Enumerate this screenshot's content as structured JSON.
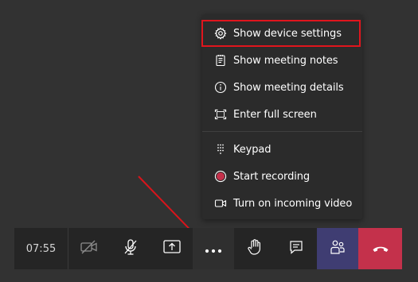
{
  "menu": {
    "items": [
      {
        "label": "Show device settings",
        "icon": "gear-icon"
      },
      {
        "label": "Show meeting notes",
        "icon": "notes-icon"
      },
      {
        "label": "Show meeting details",
        "icon": "info-icon"
      },
      {
        "label": "Enter full screen",
        "icon": "fullscreen-icon"
      },
      {
        "label": "Keypad",
        "icon": "keypad-icon"
      },
      {
        "label": "Start recording",
        "icon": "record-icon"
      },
      {
        "label": "Turn on incoming video",
        "icon": "video-icon"
      }
    ]
  },
  "toolbar": {
    "timer": "07:55",
    "buttons": [
      "camera-off-icon",
      "mic-off-icon",
      "share-screen-icon",
      "more-options-icon",
      "raise-hand-icon",
      "chat-icon",
      "participants-icon",
      "hang-up-icon"
    ]
  },
  "colors": {
    "highlight": "#e0151d",
    "arrow": "#d9141b",
    "hangup": "#c4314b",
    "participants": "#3f3d72",
    "record": "#c4314b"
  }
}
